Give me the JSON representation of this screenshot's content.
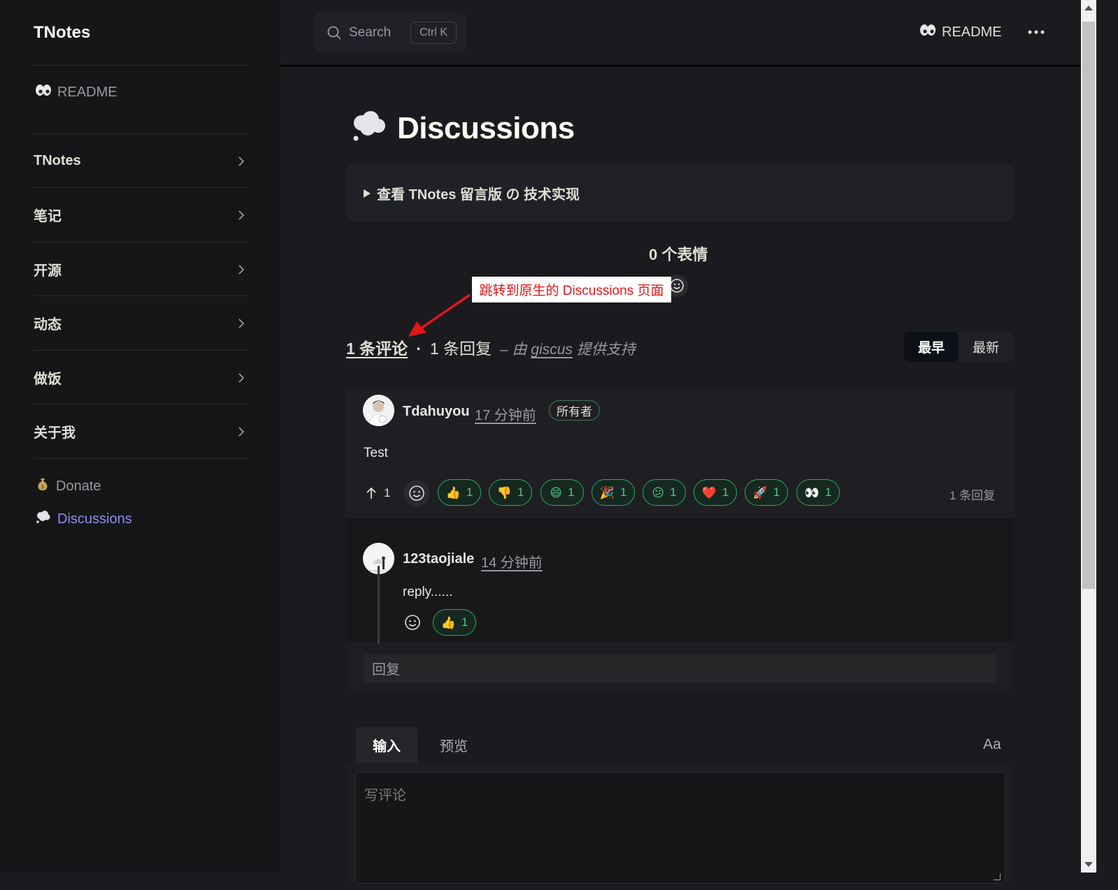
{
  "site": {
    "logo": "TNotes"
  },
  "sidebar": {
    "readme": "README",
    "groups": [
      "TNotes",
      "笔记",
      "开源",
      "动态",
      "做饭",
      "关于我"
    ],
    "donate": "Donate",
    "discussions": "Discussions"
  },
  "navbar": {
    "search_label": "Search",
    "search_shortcut": "Ctrl K",
    "readme": "README"
  },
  "page": {
    "title": "Discussions",
    "details_summary": "查看 TNotes 留言版 の 技术实现",
    "reactions_count": "0 个表情",
    "annotation": "跳转到原生的 Discussions 页面"
  },
  "giscus": {
    "comments_count": "1 条评论",
    "separator": "·",
    "replies_count": "1 条回复",
    "powered_prefix": "– 由",
    "powered_link": "giscus",
    "powered_suffix": "提供支持",
    "sort_oldest": "最早",
    "sort_newest": "最新",
    "comment": {
      "author": "Tdahuyou",
      "time": "17 分钟前",
      "badge": "所有者",
      "body": "Test",
      "upvotes": "1",
      "reactions": [
        {
          "emoji": "👍",
          "count": "1"
        },
        {
          "emoji": "👎",
          "count": "1"
        },
        {
          "emoji": "😄",
          "count": "1"
        },
        {
          "emoji": "🎉",
          "count": "1"
        },
        {
          "emoji": "😕",
          "count": "1"
        },
        {
          "emoji": "❤️",
          "count": "1"
        },
        {
          "emoji": "🚀",
          "count": "1"
        },
        {
          "emoji": "👀",
          "count": "1"
        }
      ],
      "replies_label": "1 条回复"
    },
    "reply": {
      "author": "123taojiale",
      "time": "14 分钟前",
      "body": "reply......",
      "reactions": [
        {
          "emoji": "👍",
          "count": "1"
        }
      ]
    },
    "reply_placeholder": "回复",
    "composer": {
      "tab_write": "输入",
      "tab_preview": "预览",
      "format": "Aa",
      "placeholder": "写评论"
    }
  },
  "colors": {
    "accent": "#8b8ef0",
    "reaction_border": "#2ea66b",
    "annotation_red": "#e0161a"
  }
}
